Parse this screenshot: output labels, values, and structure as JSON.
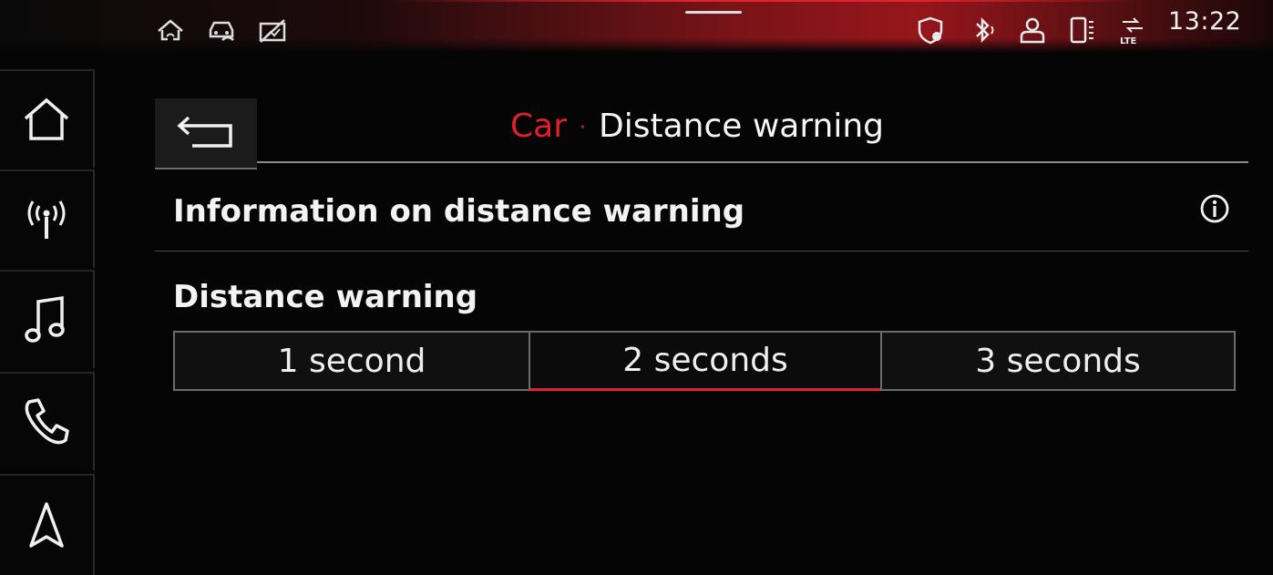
{
  "status_bar": {
    "time": "13:22",
    "left_icons": [
      "home-network-icon",
      "car-service-icon",
      "no-signal-icon"
    ],
    "right_icons": [
      "shield-location-icon",
      "bluetooth-icon",
      "user-icon",
      "phone-icon",
      "lte-icon"
    ]
  },
  "sidebar": {
    "items": [
      {
        "icon": "home-icon"
      },
      {
        "icon": "radio-icon"
      },
      {
        "icon": "music-icon"
      },
      {
        "icon": "phone-icon"
      },
      {
        "icon": "navigation-icon"
      }
    ]
  },
  "header": {
    "breadcrumb": "Car",
    "separator": "·",
    "title": "Distance warning"
  },
  "info_row": {
    "label": "Information on distance warning"
  },
  "distance_warning": {
    "label": "Distance warning",
    "options": [
      {
        "label": "1 second"
      },
      {
        "label": "2 seconds"
      },
      {
        "label": "3 seconds"
      }
    ],
    "selected": "2 seconds"
  },
  "colors": {
    "accent": "#e3222d",
    "background": "#050505",
    "text": "#f2f2f2"
  }
}
